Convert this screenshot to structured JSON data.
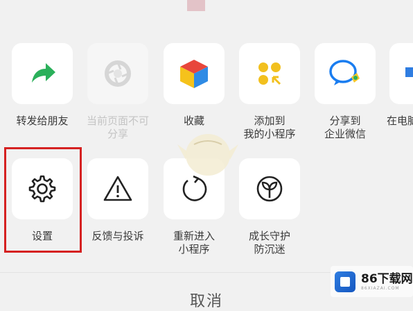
{
  "share_row": [
    {
      "label_lines": [
        "转发给朋友"
      ],
      "icon": "forward-arrow-icon"
    },
    {
      "label_lines": [
        "当前页面不可",
        "分享"
      ],
      "icon": "shutter-icon",
      "disabled": true
    },
    {
      "label_lines": [
        "收藏"
      ],
      "icon": "cube-icon"
    },
    {
      "label_lines": [
        "添加到",
        "我的小程序"
      ],
      "icon": "mini-program-icon"
    },
    {
      "label_lines": [
        "分享到",
        "企业微信"
      ],
      "icon": "wecom-icon"
    },
    {
      "label_lines": [
        "在电脑"
      ],
      "icon": "computer-icon"
    }
  ],
  "action_row": [
    {
      "label_lines": [
        "设置"
      ],
      "icon": "gear-icon",
      "highlighted": true
    },
    {
      "label_lines": [
        "反馈与投诉"
      ],
      "icon": "warning-icon"
    },
    {
      "label_lines": [
        "重新进入",
        "小程序"
      ],
      "icon": "refresh-icon"
    },
    {
      "label_lines": [
        "成长守护",
        "防沉迷"
      ],
      "icon": "sprout-icon"
    }
  ],
  "cancel_label": "取消",
  "watermark": {
    "brand": "86下载网",
    "site": "86XIAZAI.COM"
  },
  "colors": {
    "highlight": "#d52121",
    "wecom_blue": "#1a7df0",
    "forward_green": "#2bb05b"
  }
}
